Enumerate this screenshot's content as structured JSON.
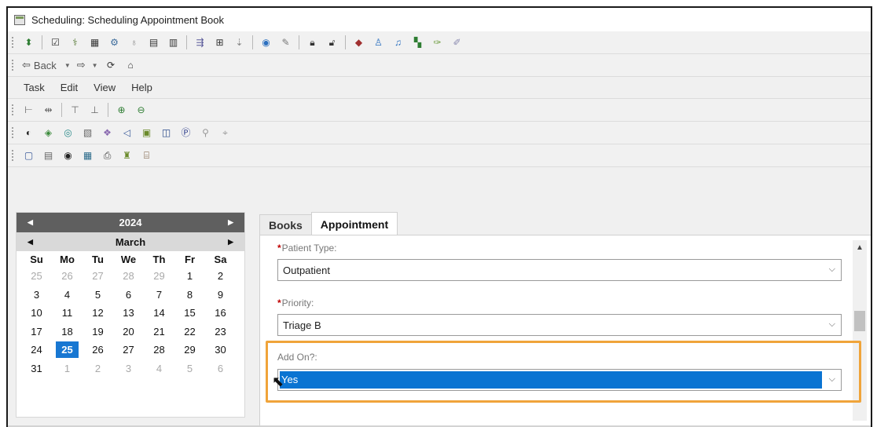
{
  "window": {
    "title": "Scheduling: Scheduling Appointment Book"
  },
  "toolbar1": {
    "icons": [
      "insert-icon",
      "check-icon",
      "person-edit-icon",
      "calendar-edit-icon",
      "schedule-icon",
      "bulb-icon",
      "grid-icon",
      "print-icon",
      "split-icon",
      "move-icon",
      "tree-icon",
      "target-icon",
      "pencil-icon",
      "lock-icon",
      "unlock-icon",
      "cube-icon",
      "person-icon",
      "book-icon",
      "chart-icon",
      "pen-icon",
      "eraser-icon"
    ]
  },
  "nav": {
    "back_label": "Back"
  },
  "menu": {
    "items": [
      "Task",
      "Edit",
      "View",
      "Help"
    ]
  },
  "calendar": {
    "year": "2024",
    "month": "March",
    "dow": [
      "Su",
      "Mo",
      "Tu",
      "We",
      "Th",
      "Fr",
      "Sa"
    ],
    "weeks": [
      [
        {
          "d": "25",
          "o": true
        },
        {
          "d": "26",
          "o": true
        },
        {
          "d": "27",
          "o": true
        },
        {
          "d": "28",
          "o": true
        },
        {
          "d": "29",
          "o": true
        },
        {
          "d": "1"
        },
        {
          "d": "2"
        }
      ],
      [
        {
          "d": "3"
        },
        {
          "d": "4"
        },
        {
          "d": "5"
        },
        {
          "d": "6"
        },
        {
          "d": "7"
        },
        {
          "d": "8"
        },
        {
          "d": "9"
        }
      ],
      [
        {
          "d": "10"
        },
        {
          "d": "11"
        },
        {
          "d": "12"
        },
        {
          "d": "13"
        },
        {
          "d": "14"
        },
        {
          "d": "15"
        },
        {
          "d": "16"
        }
      ],
      [
        {
          "d": "17"
        },
        {
          "d": "18"
        },
        {
          "d": "19"
        },
        {
          "d": "20"
        },
        {
          "d": "21"
        },
        {
          "d": "22"
        },
        {
          "d": "23"
        }
      ],
      [
        {
          "d": "24"
        },
        {
          "d": "25",
          "s": true
        },
        {
          "d": "26"
        },
        {
          "d": "27"
        },
        {
          "d": "28"
        },
        {
          "d": "29"
        },
        {
          "d": "30"
        }
      ],
      [
        {
          "d": "31"
        },
        {
          "d": "1",
          "o": true
        },
        {
          "d": "2",
          "o": true
        },
        {
          "d": "3",
          "o": true
        },
        {
          "d": "4",
          "o": true
        },
        {
          "d": "5",
          "o": true
        },
        {
          "d": "6",
          "o": true
        }
      ]
    ]
  },
  "tabs": [
    {
      "label": "Books",
      "active": false
    },
    {
      "label": "Appointment",
      "active": true
    }
  ],
  "form": {
    "patient_type": {
      "label": "Patient Type:",
      "value": "Outpatient"
    },
    "priority": {
      "label": "Priority:",
      "value": "Triage B"
    },
    "add_on": {
      "label": "Add On?:",
      "value": "Yes"
    }
  },
  "colors": {
    "selected": "#1877d2",
    "highlight_border": "#f0a43a",
    "required": "#c00000"
  }
}
